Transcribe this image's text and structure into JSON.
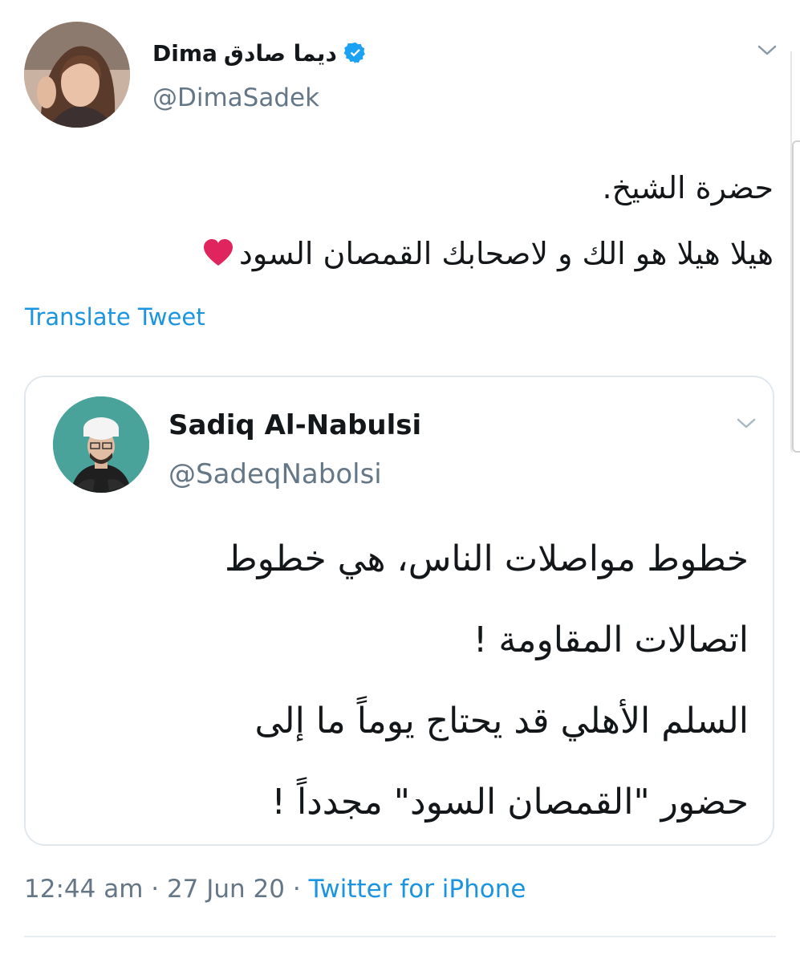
{
  "author": {
    "name_latin": "Dima",
    "name_arabic": "ديما صادق",
    "handle": "@DimaSadek",
    "verified_icon": "verified-badge-icon",
    "more_icon": "chevron-down-icon"
  },
  "tweet": {
    "lines": [
      "حضرة الشيخ.",
      "هيلا هيلا هو الك و لاصحابك القمصان السود"
    ],
    "emoji": "red-heart-icon",
    "translate_label": "Translate Tweet"
  },
  "quoted": {
    "name": "Sadiq Al-Nabulsi",
    "handle": "@SadeqNabolsi",
    "more_icon": "chevron-down-icon",
    "lines": [
      "خطوط مواصلات الناس، هي خطوط",
      "اتصالات المقاومة !",
      "السلم الأهلي قد يحتاج يوماً ما إلى",
      "حضور \"القمصان السود\" مجدداً !"
    ]
  },
  "meta": {
    "time": "12:44 am",
    "sep1": " · ",
    "date": "27 Jun 20",
    "sep2": " · ",
    "source": "Twitter for iPhone"
  },
  "colors": {
    "link": "#1b95e0",
    "secondary": "#657786",
    "border": "#e1e8ed",
    "heart": "#e0245e"
  }
}
